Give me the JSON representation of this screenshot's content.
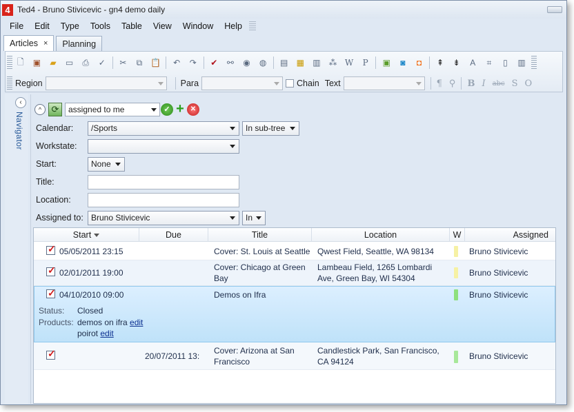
{
  "window": {
    "title": "Ted4 - Bruno Stivicevic - gn4 demo daily",
    "app_badge": "4"
  },
  "menu": [
    "File",
    "Edit",
    "Type",
    "Tools",
    "Table",
    "View",
    "Window",
    "Help"
  ],
  "tabs": [
    {
      "label": "Articles",
      "close": "×",
      "active": true
    },
    {
      "label": "Planning",
      "active": false
    }
  ],
  "toolbar2": {
    "region_label": "Region",
    "para_label": "Para",
    "chain_label": "Chain",
    "text_label": "Text",
    "format_glyphs": [
      "¶",
      "⚲",
      "B",
      "I",
      "abc",
      "S",
      "O"
    ]
  },
  "navigator": {
    "label": "Navigator",
    "collapse": "‹"
  },
  "filter": {
    "query": "assigned to me",
    "collapse_glyph": "^",
    "refresh_glyph": "⟳",
    "ok_glyph": "✓",
    "add_glyph": "+",
    "delete_glyph": "✕",
    "calendar_label": "Calendar:",
    "calendar_value": "/Sports",
    "calendar_scope": "In sub-tree",
    "workstate_label": "Workstate:",
    "workstate_value": "",
    "start_label": "Start:",
    "start_value": "None",
    "title_label": "Title:",
    "title_value": "",
    "location_label": "Location:",
    "location_value": "",
    "assigned_label": "Assigned to:",
    "assigned_value": "Bruno Stivicevic",
    "assigned_scope": "In"
  },
  "grid": {
    "columns": [
      "Start",
      "Due",
      "Title",
      "Location",
      "W",
      "Assigned"
    ],
    "rows": [
      {
        "start": "05/05/2011 23:15",
        "due": "",
        "title": "Cover: St. Louis at Seattle",
        "location": "Qwest Field, Seattle, WA 98134",
        "w_color": "#f6f1a4",
        "assigned": "Bruno Stivicevic"
      },
      {
        "start": "02/01/2011 19:00",
        "due": "",
        "title": "Cover: Chicago at Green Bay",
        "location": "Lambeau Field, 1265 Lombardi Ave, Green Bay, WI 54304",
        "w_color": "#f6f1a4",
        "assigned": "Bruno Stivicevic"
      },
      {
        "start": "04/10/2010 09:00",
        "due": "",
        "title": "Demos on Ifra",
        "location": "",
        "w_color": "#8ee07d",
        "assigned": "Bruno Stivicevic",
        "status_label": "Status:",
        "status_value": "Closed",
        "products_label": "Products:",
        "product1": "demos on ifra",
        "product2": "poirot",
        "edit_link": "edit"
      },
      {
        "start": "",
        "due": "20/07/2011 13:",
        "title": "Cover: Arizona at San Francisco",
        "location": "Candlestick Park, San Francisco, CA 94124",
        "w_color": "#a8e89a",
        "assigned": "Bruno Stivicevic"
      }
    ]
  }
}
